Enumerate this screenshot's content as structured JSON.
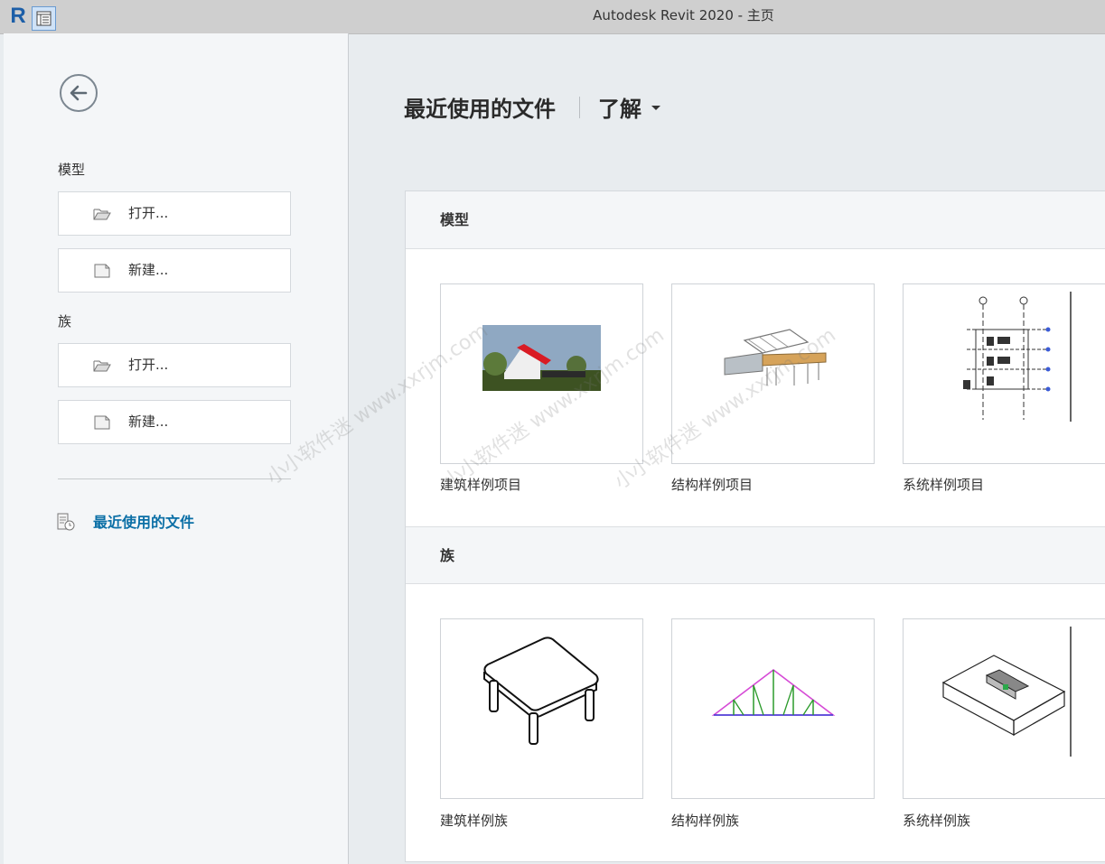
{
  "window": {
    "title": "Autodesk Revit 2020 - 主页",
    "logo_letter": "R"
  },
  "sidebar": {
    "models_label": "模型",
    "models_open": "打开...",
    "models_new": "新建...",
    "families_label": "族",
    "families_open": "打开...",
    "families_new": "新建...",
    "recent_files": "最近使用的文件"
  },
  "main": {
    "recent_heading": "最近使用的文件",
    "learn_heading": "了解",
    "models_section": "模型",
    "families_section": "族",
    "model_cards": [
      "建筑样例项目",
      "结构样例项目",
      "系统样例项目"
    ],
    "family_cards": [
      "建筑样例族",
      "结构样例族",
      "系统样例族"
    ]
  },
  "watermark": "小小软件迷 www.xxrjm.com",
  "icons": {
    "back": "back-arrow-icon",
    "open": "folder-open-icon",
    "new": "new-file-icon",
    "recent": "recent-files-icon"
  },
  "colors": {
    "link": "#0b6fa6",
    "titlebar": "#cfcfcf",
    "sidebar": "#f4f6f8",
    "main_bg": "#e8ecef"
  }
}
